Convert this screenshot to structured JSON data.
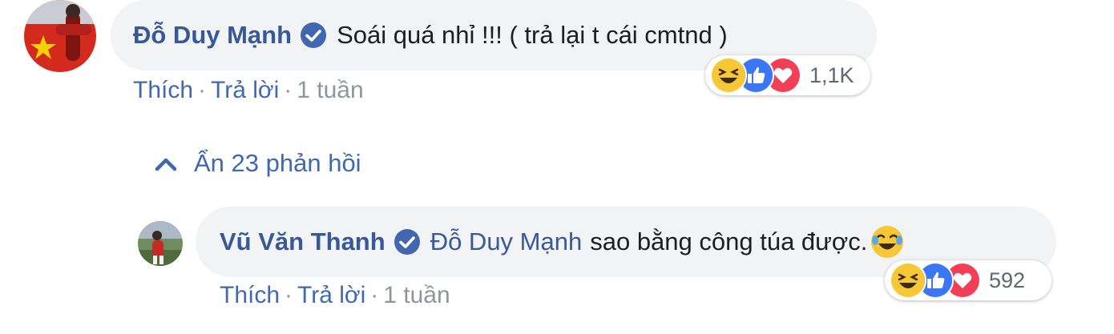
{
  "comment": {
    "author": "Đỗ Duy Mạnh",
    "text": "Soái quá nhỉ !!! ( trả lại t cái cmtnd )",
    "actions": {
      "like": "Thích",
      "reply": "Trả lời",
      "separator": "·",
      "time": "1 tuần"
    },
    "reactions": {
      "icons": [
        "haha-icon",
        "like-icon",
        "love-icon"
      ],
      "count": "1,1K"
    }
  },
  "replies_toggle": {
    "label": "Ẩn 23 phản hồi",
    "icon": "chevron-up-icon"
  },
  "reply": {
    "author": "Vũ Văn Thanh",
    "mention": "Đỗ Duy Mạnh",
    "text": "sao bằng công túa được.",
    "inline_emoji": "tears-of-joy-emoji",
    "actions": {
      "like": "Thích",
      "reply": "Trả lời",
      "separator": "·",
      "time": "1 tuần"
    },
    "reactions": {
      "icons": [
        "haha-icon",
        "like-icon",
        "love-icon"
      ],
      "count": "592"
    }
  },
  "colors": {
    "link": "#385898",
    "action_link": "#4267b2",
    "bubble": "#f2f3f5",
    "text": "#1c1e21",
    "meta": "#90949c",
    "verified": "#4267b2"
  }
}
